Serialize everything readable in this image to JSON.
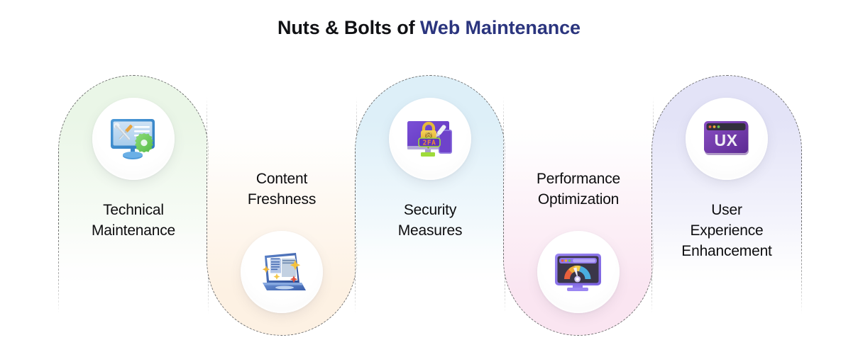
{
  "title": {
    "plain": "Nuts & Bolts of ",
    "accent": "Web Maintenance",
    "accent_color": "#2b357e",
    "plain_color": "#101114"
  },
  "cards": [
    {
      "id": "technical-maintenance",
      "label_lines": [
        "Technical",
        "Maintenance"
      ],
      "label_full": "Technical Maintenance",
      "icon_name": "monitor-tools-gear-icon",
      "orientation": "arch-top",
      "gradient_from": "#eaf6e7",
      "gradient_to": "#ffffff"
    },
    {
      "id": "content-freshness",
      "label_lines": [
        "Content",
        "Freshness"
      ],
      "label_full": "Content Freshness",
      "icon_name": "laptop-sparkle-article-icon",
      "orientation": "arch-bottom",
      "gradient_from": "#fdf1e3",
      "gradient_to": "#ffffff"
    },
    {
      "id": "security-measures",
      "label_lines": [
        "Security",
        "Measures"
      ],
      "label_full": "Security Measures",
      "icon_name": "monitor-padlock-2fa-icon",
      "orientation": "arch-top",
      "gradient_from": "#ddeff8",
      "gradient_to": "#ffffff"
    },
    {
      "id": "performance-optimization",
      "label_lines": [
        "Performance",
        "Optimization"
      ],
      "label_full": "Performance Optimization",
      "icon_name": "browser-speed-gauge-icon",
      "orientation": "arch-bottom",
      "gradient_from": "#fae5f1",
      "gradient_to": "#ffffff"
    },
    {
      "id": "user-experience-enhancement",
      "label_lines": [
        "User",
        "Experience",
        "Enhancement"
      ],
      "label_full": "User Experience Enhancement",
      "icon_name": "browser-ux-window-icon",
      "orientation": "arch-top",
      "gradient_from": "#e3e3f7",
      "gradient_to": "#ffffff"
    }
  ]
}
